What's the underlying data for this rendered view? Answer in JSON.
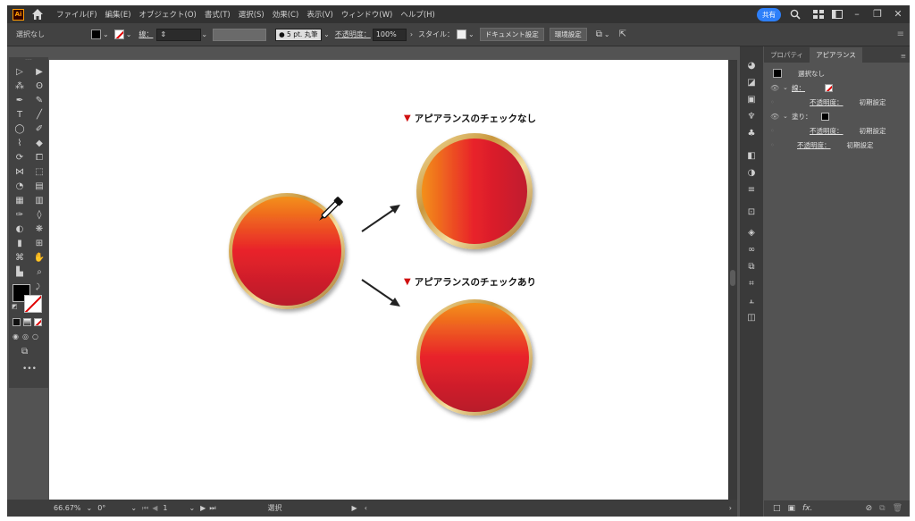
{
  "app": {
    "logo": "Ai"
  },
  "menu": [
    "ファイル(F)",
    "編集(E)",
    "オブジェクト(O)",
    "書式(T)",
    "選択(S)",
    "効果(C)",
    "表示(V)",
    "ウィンドウ(W)",
    "ヘルプ(H)"
  ],
  "menu_right": {
    "share": "共有"
  },
  "control": {
    "selection": "選択なし",
    "stroke_label": "線：",
    "brush": "5 pt. 丸筆",
    "opacity_label": "不透明度：",
    "opacity_value": "100%",
    "style_label": "スタイル：",
    "doc_settings": "ドキュメント設定",
    "prefs": "環境設定"
  },
  "status": {
    "zoom": "66.67%",
    "rotate": "0°",
    "page": "1",
    "mode": "選択"
  },
  "canvas": {
    "heading_without": "アピアランスのチェックなし",
    "heading_with": "アピアランスのチェックあり"
  },
  "panel": {
    "tabs": [
      "プロパティ",
      "アピアランス"
    ],
    "active_tab": "アピアランス",
    "selection": "選択なし",
    "stroke_label": "線：",
    "opacity_label": "不透明度：",
    "default_label": "初期設定",
    "fill_label": "塗り：",
    "fx_label": "fx."
  },
  "colors": {
    "accent_red": "#d01010",
    "gradient_top": "#f39019",
    "gradient_mid": "#e8212a",
    "gradient_bottom": "#b81d2a",
    "gold": "#d8b15a"
  }
}
